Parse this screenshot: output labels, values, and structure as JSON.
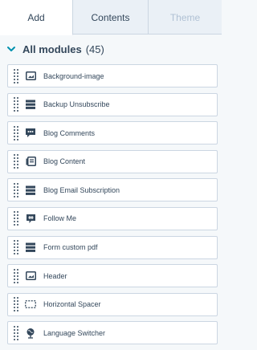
{
  "tabs": [
    {
      "label": "Add",
      "state": "active"
    },
    {
      "label": "Contents",
      "state": "normal"
    },
    {
      "label": "Theme",
      "state": "disabled"
    }
  ],
  "section": {
    "title": "All modules",
    "count": "(45)",
    "expanded": true,
    "icon": "chevron-down-icon"
  },
  "modules": [
    {
      "label": "Background-image",
      "icon": "image-icon"
    },
    {
      "label": "Backup Unsubscribe",
      "icon": "form-icon"
    },
    {
      "label": "Blog Comments",
      "icon": "comment-icon"
    },
    {
      "label": "Blog Content",
      "icon": "blog-content-icon"
    },
    {
      "label": "Blog Email Subscription",
      "icon": "form-icon"
    },
    {
      "label": "Follow Me",
      "icon": "follow-icon"
    },
    {
      "label": "Form custom pdf",
      "icon": "form-icon"
    },
    {
      "label": "Header",
      "icon": "image-icon"
    },
    {
      "label": "Horizontal Spacer",
      "icon": "spacer-icon"
    },
    {
      "label": "Language Switcher",
      "icon": "globe-icon"
    }
  ],
  "colors": {
    "text": "#33475b",
    "border": "#cbd6e2",
    "tab_bg": "#eaf0f6",
    "panel_bg": "#f5f8fa",
    "disabled": "#b0c1d4",
    "accent": "#0091ae"
  }
}
